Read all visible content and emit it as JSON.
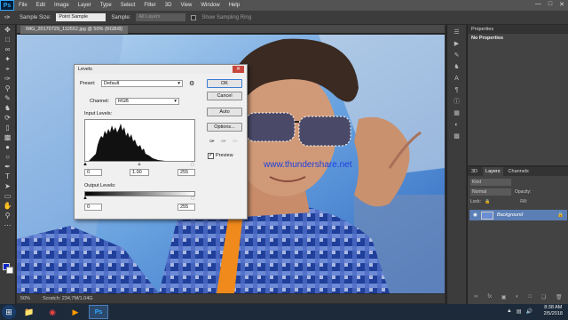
{
  "menubar": {
    "logo": "Ps",
    "items": [
      "File",
      "Edit",
      "Image",
      "Layer",
      "Type",
      "Select",
      "Filter",
      "3D",
      "View",
      "Window",
      "Help"
    ]
  },
  "options": {
    "sample_size_label": "Sample Size:",
    "sample_size_value": "Point Sample",
    "sample_label": "Sample:",
    "sample_value": "All Layers",
    "show_ring_label": "Show Sampling Ring"
  },
  "document": {
    "tab_title": "IMG_20170729_110552.jpg @ 50% (RGB/8)",
    "zoom": "50%",
    "scratch": "Scratch: 234.7M/1.04G"
  },
  "watermark": "www.thundershare.net",
  "panels": {
    "properties_tab": "Properties",
    "properties_title": "No Properties",
    "layers_tabs": [
      "3D",
      "Layers",
      "Channels"
    ],
    "kind": "Kind",
    "blend_mode": "Normal",
    "opacity_label": "Opacity:",
    "lock_label": "Lock:",
    "fill_label": "Fill:",
    "layer_name": "Background"
  },
  "levels": {
    "title": "Levels",
    "preset_label": "Preset:",
    "preset_value": "Default",
    "channel_label": "Channel:",
    "channel_value": "RGB",
    "input_levels_label": "Input Levels:",
    "input_black": "0",
    "input_gamma": "1.00",
    "input_white": "255",
    "output_levels_label": "Output Levels:",
    "output_black": "0",
    "output_white": "255",
    "ok": "OK",
    "cancel": "Cancel",
    "auto": "Auto",
    "options": "Options...",
    "preview_label": "Preview"
  },
  "taskbar": {
    "time": "8:38 AM",
    "date": "2/5/2018"
  },
  "colors": {
    "foreground": "#0024c8",
    "background": "#ffffff",
    "ui_dark": "#3c3c3c",
    "selection_blue": "#5b7fb5"
  }
}
